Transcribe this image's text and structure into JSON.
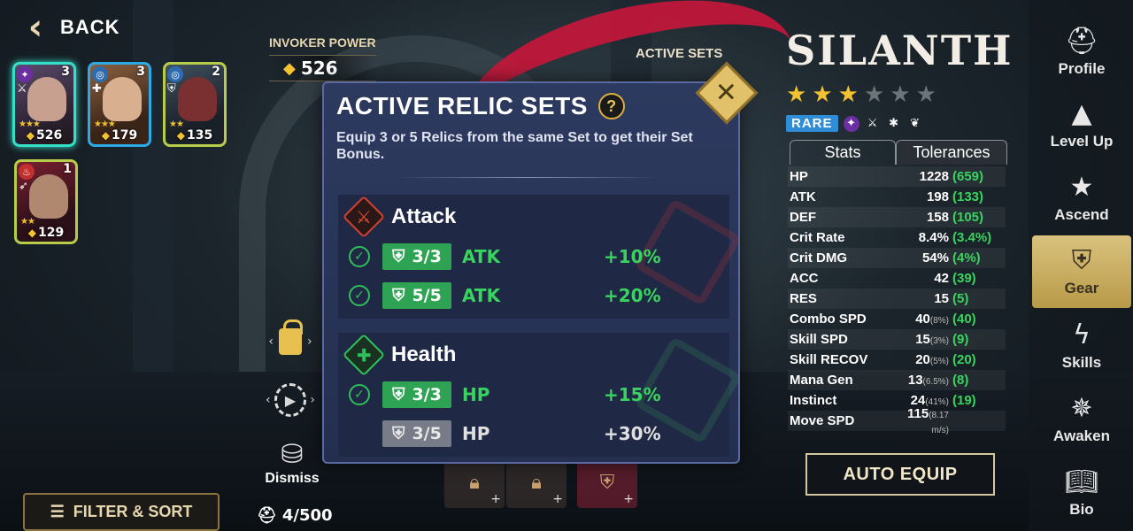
{
  "back": {
    "label": "BACK"
  },
  "invoker": {
    "label": "INVOKER POWER",
    "value": "526"
  },
  "cards": [
    {
      "level": "3",
      "power": "526",
      "stars": "★★★"
    },
    {
      "level": "3",
      "power": "179",
      "stars": "★★★"
    },
    {
      "level": "2",
      "power": "135",
      "stars": "★★"
    },
    {
      "level": "1",
      "power": "129",
      "stars": "★★"
    }
  ],
  "filter": {
    "label": "FILTER & SORT"
  },
  "dismiss": {
    "label": "Dismiss"
  },
  "capacity": {
    "value": "4/500"
  },
  "modal": {
    "title": "ACTIVE RELIC SETS",
    "description": "Equip 3 or 5 Relics from the same Set to get their Set Bonus.",
    "sets": [
      {
        "name": "Attack",
        "bonuses": [
          {
            "req": "3/3",
            "stat": "ATK",
            "pct": "+10%",
            "active": true
          },
          {
            "req": "5/5",
            "stat": "ATK",
            "pct": "+20%",
            "active": true
          }
        ]
      },
      {
        "name": "Health",
        "bonuses": [
          {
            "req": "3/3",
            "stat": "HP",
            "pct": "+15%",
            "active": true
          },
          {
            "req": "3/5",
            "stat": "HP",
            "pct": "+30%",
            "active": false
          }
        ]
      }
    ]
  },
  "bg_label": "ACTIVE SETS",
  "hero": {
    "name": "SILANTH",
    "stars_on": 3,
    "stars_total": 6,
    "rarity": "RARE"
  },
  "stat_tabs": {
    "stats": "Stats",
    "tolerances": "Tolerances"
  },
  "stats": [
    {
      "label": "HP",
      "value": "1228",
      "sub": "",
      "bonus": "(659)"
    },
    {
      "label": "ATK",
      "value": "198",
      "sub": "",
      "bonus": "(133)"
    },
    {
      "label": "DEF",
      "value": "158",
      "sub": "",
      "bonus": "(105)"
    },
    {
      "label": "Crit Rate",
      "value": "8.4%",
      "sub": "",
      "bonus": "(3.4%)"
    },
    {
      "label": "Crit DMG",
      "value": "54%",
      "sub": "",
      "bonus": "(4%)"
    },
    {
      "label": "ACC",
      "value": "42",
      "sub": "",
      "bonus": "(39)"
    },
    {
      "label": "RES",
      "value": "15",
      "sub": "",
      "bonus": "(5)"
    },
    {
      "label": "Combo SPD",
      "value": "40",
      "sub": "(8%)",
      "bonus": "(40)"
    },
    {
      "label": "Skill SPD",
      "value": "15",
      "sub": "(3%)",
      "bonus": "(9)"
    },
    {
      "label": "Skill RECOV",
      "value": "20",
      "sub": "(5%)",
      "bonus": "(20)"
    },
    {
      "label": "Mana Gen",
      "value": "13",
      "sub": "(6.5%)",
      "bonus": "(8)"
    },
    {
      "label": "Instinct",
      "value": "24",
      "sub": "(41%)",
      "bonus": "(19)"
    },
    {
      "label": "Move SPD",
      "value": "115",
      "sub": "(8.17 m/s)",
      "bonus": ""
    }
  ],
  "auto_equip": {
    "label": "AUTO EQUIP"
  },
  "nav": [
    {
      "label": "Profile",
      "icon": "helmet-icon"
    },
    {
      "label": "Level Up",
      "icon": "level-up-icon"
    },
    {
      "label": "Ascend",
      "icon": "star-icon"
    },
    {
      "label": "Gear",
      "icon": "armor-icon"
    },
    {
      "label": "Skills",
      "icon": "skills-icon"
    },
    {
      "label": "Awaken",
      "icon": "awaken-icon"
    },
    {
      "label": "Bio",
      "icon": "book-icon"
    }
  ],
  "colors": {
    "accent_gold": "#d9c27e",
    "bonus_green": "#39d45f",
    "rare_blue": "#2f8dd8",
    "selected_teal": "#35e0c9"
  }
}
